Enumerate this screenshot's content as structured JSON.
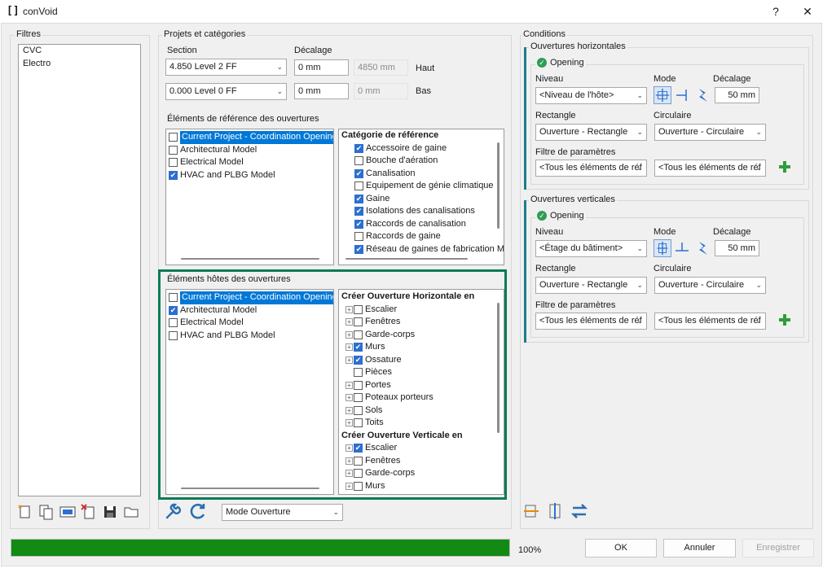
{
  "window": {
    "icon": "[]",
    "title": "conVoid",
    "help": "?",
    "close": "✕"
  },
  "filters": {
    "title": "Filtres",
    "items": [
      "CVC",
      "Electro"
    ]
  },
  "projects": {
    "title": "Projets et catégories",
    "section_label": "Section",
    "offset_label": "Décalage",
    "top": {
      "level": "4.850  Level 2 FF",
      "offset": "0 mm",
      "computed": "4850 mm",
      "side": "Haut"
    },
    "bottom": {
      "level": "0.000  Level 0 FF",
      "offset": "0 mm",
      "computed": "0 mm",
      "side": "Bas"
    },
    "ref_title": "Éléments de référence des ouvertures",
    "ref_models": [
      {
        "label": "Current Project - Coordination Openings",
        "checked": false,
        "selected": true
      },
      {
        "label": "Architectural Model",
        "checked": false,
        "selected": false
      },
      {
        "label": "Electrical Model",
        "checked": false,
        "selected": false
      },
      {
        "label": "HVAC and PLBG Model",
        "checked": true,
        "selected": false
      }
    ],
    "ref_cat_header": "Catégorie de référence",
    "ref_categories": [
      {
        "label": "Accessoire de gaine",
        "checked": true
      },
      {
        "label": "Bouche d'aération",
        "checked": false
      },
      {
        "label": "Canalisation",
        "checked": true
      },
      {
        "label": "Equipement de génie climatique",
        "checked": false
      },
      {
        "label": "Gaine",
        "checked": true
      },
      {
        "label": "Isolations des canalisations",
        "checked": true
      },
      {
        "label": "Raccords de canalisation",
        "checked": true
      },
      {
        "label": "Raccords de gaine",
        "checked": false
      },
      {
        "label": "Réseau de gaines de fabrication M",
        "checked": true
      }
    ],
    "host_title": "Éléments hôtes des ouvertures",
    "host_models": [
      {
        "label": "Current Project - Coordination Openings",
        "checked": false,
        "selected": true
      },
      {
        "label": "Architectural Model",
        "checked": true,
        "selected": false
      },
      {
        "label": "Electrical Model",
        "checked": false,
        "selected": false
      },
      {
        "label": "HVAC and PLBG Model",
        "checked": false,
        "selected": false
      }
    ],
    "host_tree": [
      {
        "header": true,
        "label": "Créer Ouverture Horizontale en"
      },
      {
        "label": "Escalier",
        "checked": false,
        "expand": true
      },
      {
        "label": "Fenêtres",
        "checked": false,
        "expand": true
      },
      {
        "label": "Garde-corps",
        "checked": false,
        "expand": true
      },
      {
        "label": "Murs",
        "checked": true,
        "expand": true
      },
      {
        "label": "Ossature",
        "checked": true,
        "expand": true
      },
      {
        "label": "Pièces",
        "checked": false,
        "expand": false
      },
      {
        "label": "Portes",
        "checked": false,
        "expand": true
      },
      {
        "label": "Poteaux porteurs",
        "checked": false,
        "expand": true
      },
      {
        "label": "Sols",
        "checked": false,
        "expand": true
      },
      {
        "label": "Toits",
        "checked": false,
        "expand": true
      },
      {
        "header": true,
        "label": "Créer Ouverture Verticale en"
      },
      {
        "label": "Escalier",
        "checked": true,
        "expand": true
      },
      {
        "label": "Fenêtres",
        "checked": false,
        "expand": true
      },
      {
        "label": "Garde-corps",
        "checked": false,
        "expand": true
      },
      {
        "label": "Murs",
        "checked": false,
        "expand": true
      }
    ],
    "mode_select": "Mode Ouverture"
  },
  "conditions": {
    "title": "Conditions",
    "horizontal": {
      "title": "Ouvertures horizontales",
      "opening": "Opening",
      "level_label": "Niveau",
      "mode_label": "Mode",
      "offset_label": "Décalage",
      "level": "<Niveau de l'hôte>",
      "offset": "50 mm",
      "rect_label": "Rectangle",
      "circ_label": "Circulaire",
      "rect": "Ouverture - Rectangle",
      "circ": "Ouverture - Circulaire",
      "filter_label": "Filtre de paramètres",
      "filter1": "<Tous les éléments de réf",
      "filter2": "<Tous les éléments de réf"
    },
    "vertical": {
      "title": "Ouvertures verticales",
      "opening": "Opening",
      "level_label": "Niveau",
      "mode_label": "Mode",
      "offset_label": "Décalage",
      "level": "<Étage du bâtiment>",
      "offset": "50 mm",
      "rect_label": "Rectangle",
      "circ_label": "Circulaire",
      "rect": "Ouverture - Rectangle",
      "circ": "Ouverture - Circulaire",
      "filter_label": "Filtre de paramètres",
      "filter1": "<Tous les éléments de réf",
      "filter2": "<Tous les éléments de réf"
    }
  },
  "progress": {
    "value": 1.0,
    "label": "100%"
  },
  "buttons": {
    "ok": "OK",
    "cancel": "Annuler",
    "save": "Enregistrer"
  },
  "colors": {
    "accent_green": "#0b7a57",
    "progress": "#138a13",
    "selection": "#0078d7"
  }
}
